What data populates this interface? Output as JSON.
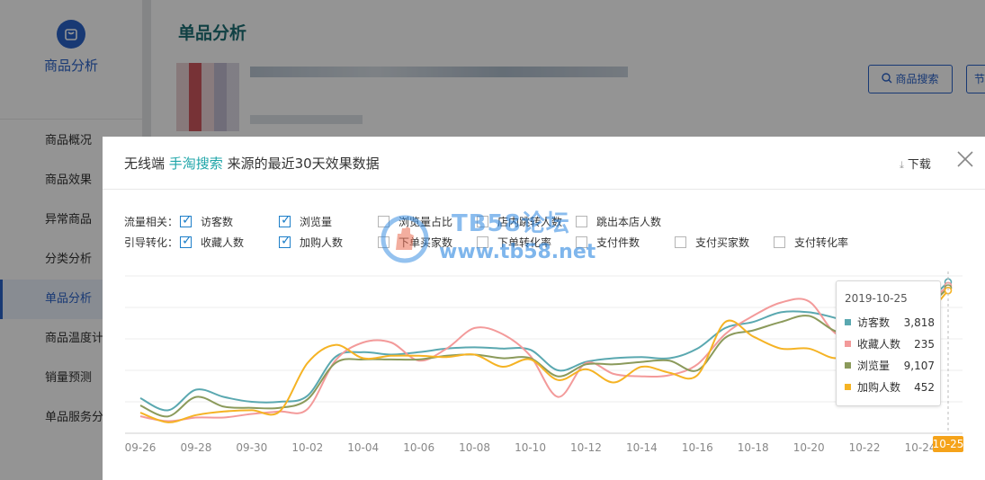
{
  "sidebar": {
    "brand_label": "商品分析",
    "items": [
      {
        "label": "商品概况"
      },
      {
        "label": "商品效果"
      },
      {
        "label": "异常商品"
      },
      {
        "label": "分类分析"
      },
      {
        "label": "单品分析",
        "active": true
      },
      {
        "label": "商品温度计"
      },
      {
        "label": "销量预测"
      },
      {
        "label": "单品服务分析"
      }
    ]
  },
  "main": {
    "page_title": "单品分析",
    "search_button": "商品搜索",
    "more_button": "节"
  },
  "modal": {
    "title_prefix": "无线端",
    "title_highlight": "手淘搜索",
    "title_suffix": "来源的最近30天效果数据",
    "download_label": "下载",
    "traffic_label": "流量相关：",
    "conversion_label": "引导转化：",
    "traffic_metrics": [
      {
        "label": "访客数",
        "checked": true
      },
      {
        "label": "浏览量",
        "checked": true
      },
      {
        "label": "浏览量占比",
        "checked": false
      },
      {
        "label": "店内跳转人数",
        "checked": false
      },
      {
        "label": "跳出本店人数",
        "checked": false
      }
    ],
    "conversion_metrics": [
      {
        "label": "收藏人数",
        "checked": true
      },
      {
        "label": "加购人数",
        "checked": true
      },
      {
        "label": "下单买家数",
        "checked": false
      },
      {
        "label": "下单转化率",
        "checked": false
      },
      {
        "label": "支付件数",
        "checked": false
      },
      {
        "label": "支付买家数",
        "checked": false
      },
      {
        "label": "支付转化率",
        "checked": false
      }
    ]
  },
  "tooltip": {
    "date": "2019-10-25",
    "rows": [
      {
        "name": "访客数",
        "value": "3,818",
        "color": "#5aa8b0"
      },
      {
        "name": "收藏人数",
        "value": "235",
        "color": "#f39a9a"
      },
      {
        "name": "浏览量",
        "value": "9,107",
        "color": "#8b9a5b"
      },
      {
        "name": "加购人数",
        "value": "452",
        "color": "#f5b324"
      }
    ]
  },
  "watermark": {
    "line1": "TB58论坛",
    "line2": "www.tb58.net"
  },
  "chart_data": {
    "type": "line",
    "x": [
      "09-26",
      "09-27",
      "09-28",
      "09-29",
      "09-30",
      "10-01",
      "10-02",
      "10-03",
      "10-04",
      "10-05",
      "10-06",
      "10-07",
      "10-08",
      "10-09",
      "10-10",
      "10-11",
      "10-12",
      "10-13",
      "10-14",
      "10-15",
      "10-16",
      "10-17",
      "10-18",
      "10-19",
      "10-20",
      "10-21",
      "10-22",
      "10-23",
      "10-24",
      "10-25"
    ],
    "x_tick_labels": [
      "09-26",
      "09-28",
      "09-30",
      "10-02",
      "10-04",
      "10-06",
      "10-08",
      "10-10",
      "10-12",
      "10-14",
      "10-16",
      "10-18",
      "10-20",
      "10-22",
      "10-24",
      "10-25"
    ],
    "highlight_x": "10-25",
    "series": [
      {
        "name": "访客数",
        "color": "#5aa8b0",
        "values": [
          0.29,
          0.19,
          0.36,
          0.3,
          0.26,
          0.26,
          0.31,
          0.63,
          0.67,
          0.65,
          0.67,
          0.7,
          0.71,
          0.7,
          0.69,
          0.52,
          0.59,
          0.62,
          0.63,
          0.62,
          0.7,
          0.87,
          0.92,
          1.0,
          1.0,
          0.95,
          0.88,
          0.92,
          1.04,
          1.25
        ]
      },
      {
        "name": "收藏人数",
        "color": "#f39a9a",
        "values": [
          0.14,
          0.1,
          0.13,
          0.13,
          0.16,
          0.18,
          0.2,
          0.6,
          0.75,
          0.75,
          0.6,
          0.7,
          0.87,
          0.82,
          0.64,
          0.3,
          0.58,
          0.49,
          0.47,
          0.48,
          0.57,
          0.82,
          0.97,
          1.08,
          1.09,
          0.82,
          0.85,
          0.88,
          1.02,
          1.22
        ]
      },
      {
        "name": "浏览量",
        "color": "#8b9a5b",
        "values": [
          0.23,
          0.14,
          0.3,
          0.22,
          0.21,
          0.21,
          0.28,
          0.58,
          0.61,
          0.61,
          0.61,
          0.64,
          0.65,
          0.62,
          0.62,
          0.47,
          0.57,
          0.57,
          0.59,
          0.6,
          0.52,
          0.79,
          0.85,
          0.92,
          0.97,
          0.84,
          0.84,
          0.88,
          1.0,
          1.2
        ]
      },
      {
        "name": "加购人数",
        "color": "#f5b324",
        "values": [
          0.17,
          0.09,
          0.15,
          0.18,
          0.19,
          0.18,
          0.58,
          0.73,
          0.62,
          0.64,
          0.64,
          0.63,
          0.65,
          0.55,
          0.61,
          0.44,
          0.53,
          0.42,
          0.55,
          0.5,
          0.48,
          0.92,
          0.8,
          0.7,
          0.7,
          0.62,
          0.72,
          0.75,
          0.92,
          1.18
        ]
      }
    ],
    "grid": true,
    "legend": "none"
  }
}
